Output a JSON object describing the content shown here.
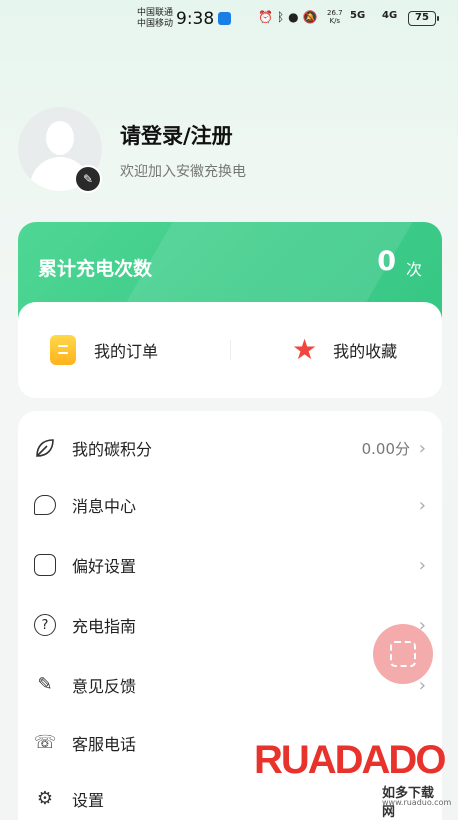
{
  "status_bar": {
    "carrier_1": "中国联通",
    "carrier_2": "中国移动",
    "time": "9:38",
    "net_speed_value": "26.7",
    "net_speed_unit": "K/s",
    "signal_1": "5G",
    "signal_2": "4G",
    "battery": "75"
  },
  "profile": {
    "login_title": "请登录/注册",
    "welcome_text": "欢迎加入安徽充换电"
  },
  "charge_card": {
    "title": "累计充电次数",
    "count": "0",
    "unit": "次"
  },
  "quick_actions": [
    {
      "label": "我的订单",
      "icon": "clipboard-icon"
    },
    {
      "label": "我的收藏",
      "icon": "star-icon"
    }
  ],
  "menu": [
    {
      "label": "我的碳积分",
      "value": "0.00分",
      "icon": "leaf-icon"
    },
    {
      "label": "消息中心",
      "value": "",
      "icon": "chat-icon"
    },
    {
      "label": "偏好设置",
      "value": "",
      "icon": "sliders-icon"
    },
    {
      "label": "充电指南",
      "value": "",
      "icon": "help-icon"
    },
    {
      "label": "意见反馈",
      "value": "",
      "icon": "pen-icon"
    },
    {
      "label": "客服电话",
      "value": "",
      "icon": "phone-icon"
    },
    {
      "label": "设置",
      "value": "",
      "icon": "gear-icon"
    }
  ],
  "watermark": {
    "logo": "RUADADO",
    "site_name": "如多下载网",
    "url": "www.ruaduo.com"
  },
  "colors": {
    "accent_green": "#3ecc8a",
    "order_icon": "#ffc12e",
    "star_icon": "#f1463d",
    "scan_button": "#f4a7a7",
    "watermark_red": "#e7332b"
  }
}
